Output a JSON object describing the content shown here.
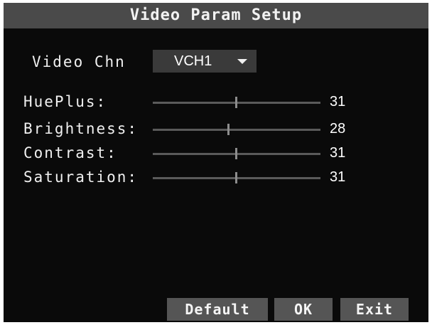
{
  "window": {
    "title": "Video Param Setup"
  },
  "video_chn": {
    "label": "Video Chn",
    "value": "VCH1",
    "dropdown_icon": "triangle-down-icon"
  },
  "params": [
    {
      "label": "HuePlus:",
      "value": "31",
      "level": 31,
      "max": 63
    },
    {
      "label": "Brightness:",
      "value": "28",
      "level": 28,
      "max": 63
    },
    {
      "label": "Contrast:",
      "value": "31",
      "level": 31,
      "max": 63
    },
    {
      "label": "Saturation:",
      "value": "31",
      "level": 31,
      "max": 63
    }
  ],
  "buttons": {
    "default_label": "Default",
    "ok_label": "OK",
    "exit_label": "Exit"
  },
  "colors": {
    "background": "#0a0a0a",
    "titlebar": "#4a4a4a",
    "button": "#555555",
    "text": "#f0f0f0"
  }
}
